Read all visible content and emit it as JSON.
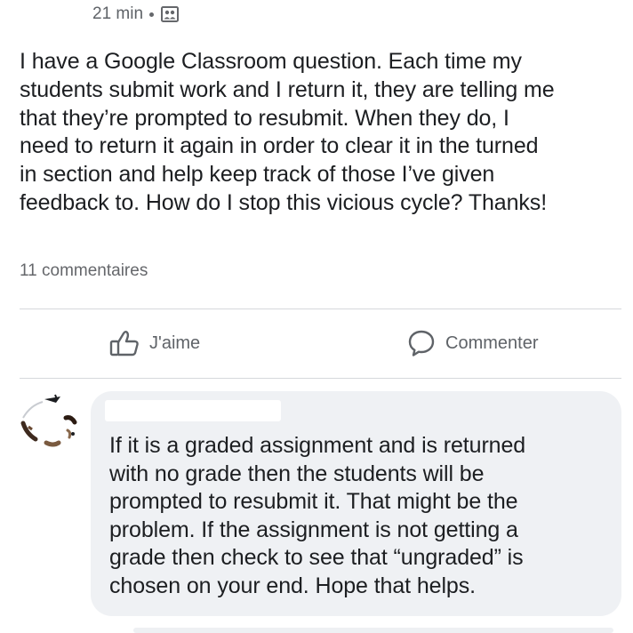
{
  "post": {
    "time_label": "21 min",
    "audience_icon": "group-audience-icon",
    "body": "I have a Google Classroom question. Each time my\nstudents submit work and I return it, they are telling me\nthat they’re prompted to resubmit. When they do, I\nneed to return it again in order to clear it in the turned\nin section and help keep track of those I’ve given\nfeedback to. How do I stop this vicious cycle? Thanks!",
    "comment_count": "11 commentaires"
  },
  "actions": {
    "like_label": "J'aime",
    "comment_label": "Commenter",
    "like_icon": "thumbs-up-icon",
    "comment_icon": "speech-bubble-icon"
  },
  "comment": {
    "text": "If it is a graded assignment and is returned\nwith no grade then the students will be\nprompted to resubmit it. That might be the\nproblem. If the assignment is not getting a\ngrade then check to see that “ungraded” is\nchosen on your end. Hope that helps."
  },
  "colors": {
    "text": "#1c1e21",
    "secondary_text": "#65676b",
    "bubble_bg": "#eff1f4",
    "divider": "#d6d8dc"
  }
}
